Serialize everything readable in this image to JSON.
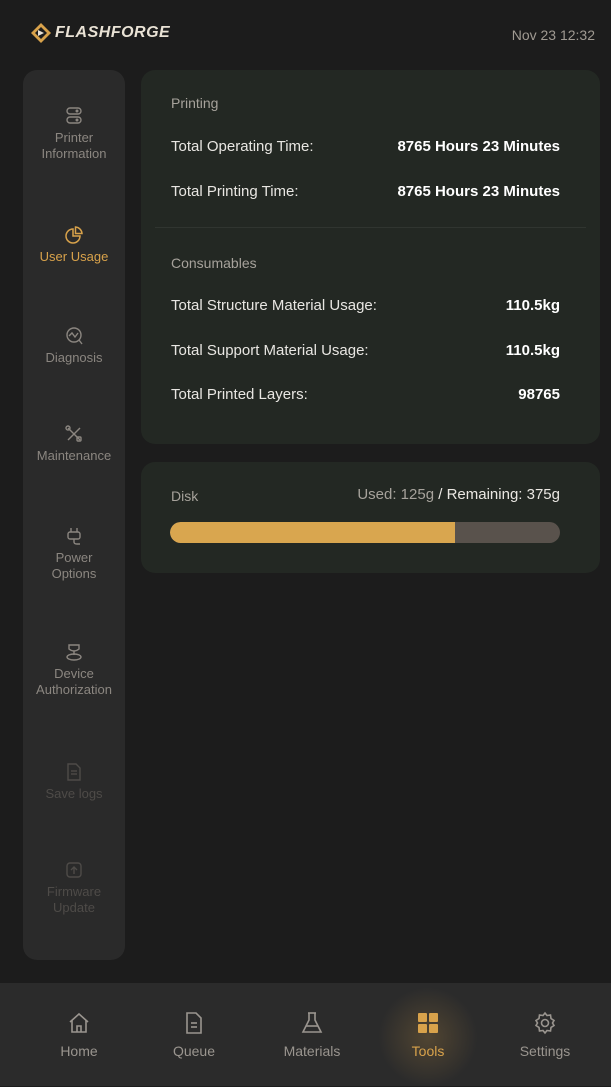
{
  "header": {
    "brand": "FLASHFORGE",
    "datetime": "Nov 23  12:32"
  },
  "sidebar": {
    "items": [
      {
        "label": "Printer Information",
        "icon": "printer-info-icon",
        "state": "normal"
      },
      {
        "label": "User Usage",
        "icon": "pie-chart-icon",
        "state": "active"
      },
      {
        "label": "Diagnosis",
        "icon": "diagnosis-icon",
        "state": "normal"
      },
      {
        "label": "Maintenance",
        "icon": "tools-icon",
        "state": "normal"
      },
      {
        "label": "Power Options",
        "icon": "plug-icon",
        "state": "normal"
      },
      {
        "label": "Device Authorization",
        "icon": "authorization-icon",
        "state": "normal"
      },
      {
        "label": "Save logs",
        "icon": "document-icon",
        "state": "disabled"
      },
      {
        "label": "Firmware Update",
        "icon": "firmware-upload-icon",
        "state": "disabled"
      }
    ]
  },
  "printing": {
    "title": "Printing",
    "operating_label": "Total Operating Time:",
    "operating_value": "8765 Hours 23 Minutes",
    "printing_label": "Total Printing Time:",
    "printing_value": "8765 Hours 23 Minutes"
  },
  "consumables": {
    "title": "Consumables",
    "structure_label": "Total Structure Material Usage:",
    "structure_value": "110.5kg",
    "support_label": "Total Support Material Usage:",
    "support_value": "110.5kg",
    "layers_label": "Total Printed Layers:",
    "layers_value": "98765"
  },
  "disk": {
    "title": "Disk",
    "used_text": "Used: 125g",
    "separator": " / ",
    "remaining_text": "Remaining: 375g",
    "used_fraction": 0.73
  },
  "nav": {
    "items": [
      {
        "label": "Home",
        "icon": "home-icon"
      },
      {
        "label": "Queue",
        "icon": "queue-document-icon"
      },
      {
        "label": "Materials",
        "icon": "flask-icon"
      },
      {
        "label": "Tools",
        "icon": "grid-icon",
        "active": true
      },
      {
        "label": "Settings",
        "icon": "gear-icon"
      }
    ]
  },
  "colors": {
    "accent": "#d8a24b",
    "bar_track": "#59524c",
    "card": "#232823",
    "background": "#1c1c1c"
  }
}
